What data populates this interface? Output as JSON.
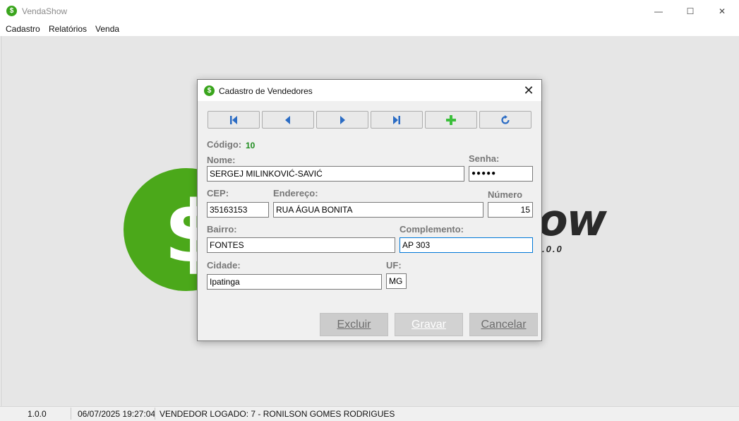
{
  "window": {
    "title": "VendaShow",
    "app_icon_glyph": "$",
    "controls": {
      "minimize": "—",
      "maximize": "☐",
      "close": "✕"
    }
  },
  "menu": {
    "items": [
      "Cadastro",
      "Relatórios",
      "Venda"
    ]
  },
  "logo": {
    "glyph": "$",
    "text": "ow",
    "version": ".0.0",
    "colors": {
      "circle": "#4ba81a",
      "text": "#2a2a2a"
    }
  },
  "status": {
    "version": "1.0.0",
    "datetime": "06/07/2025 19:27:04",
    "user": "VENDEDOR LOGADO:  7 - RONILSON GOMES RODRIGUES"
  },
  "dialog": {
    "title": "Cadastro de Vendedores",
    "icon_glyph": "$",
    "close": "✕",
    "nav_buttons": [
      {
        "name": "first-record",
        "icon": "first-icon"
      },
      {
        "name": "previous-record",
        "icon": "previous-icon"
      },
      {
        "name": "next-record",
        "icon": "next-icon"
      },
      {
        "name": "last-record",
        "icon": "last-icon"
      },
      {
        "name": "new-record",
        "icon": "plus-icon"
      },
      {
        "name": "refresh",
        "icon": "refresh-icon"
      }
    ],
    "labels": {
      "codigo": "Código:",
      "nome": "Nome:",
      "senha": "Senha:",
      "cep": "CEP:",
      "endereco": "Endereço:",
      "numero": "Número",
      "bairro": "Bairro:",
      "complemento": "Complemento:",
      "cidade": "Cidade:",
      "uf": "UF:"
    },
    "values": {
      "codigo": "10",
      "nome": "SERGEJ MILINKOVIĆ-SAVIĆ",
      "senha": "●●●●●",
      "cep": "35163153",
      "endereco": "RUA ÁGUA BONITA",
      "numero": "15",
      "bairro": "FONTES",
      "complemento": "AP 303",
      "cidade": "Ipatinga",
      "uf": "MG"
    },
    "buttons": {
      "excluir": "Excluir",
      "gravar": "Gravar",
      "cancelar": "Cancelar"
    },
    "colors": {
      "nav_icon": "#2b6cc4",
      "add_icon": "#3cbf3c",
      "codigo": "#1e8c1e"
    }
  }
}
